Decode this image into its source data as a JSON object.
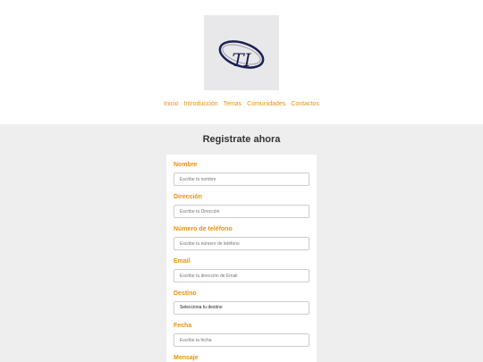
{
  "logo": {
    "text": "TI"
  },
  "nav": {
    "items": [
      "Inicio",
      "Introducción",
      "Temas",
      "Comunidades",
      "Contactos"
    ]
  },
  "form": {
    "title": "Registrate ahora",
    "fields": [
      {
        "label": "Nombre",
        "placeholder": "Escribe tu nombre"
      },
      {
        "label": "Dirección",
        "placeholder": "Escribe tu Dirección"
      },
      {
        "label": "Número de teléfono",
        "placeholder": "Escribe tu número de teléfono"
      },
      {
        "label": "Email",
        "placeholder": "Escribe tu dirección de Email"
      },
      {
        "label": "Destino",
        "value": "Selecciona tu destino"
      },
      {
        "label": "Fecha",
        "placeholder": "Escribe la fecha"
      },
      {
        "label": "Mensaje"
      }
    ]
  },
  "colors": {
    "accent": "#e8920c",
    "logo_navy": "#1d1f52",
    "page_bg": "#eeeeee"
  }
}
